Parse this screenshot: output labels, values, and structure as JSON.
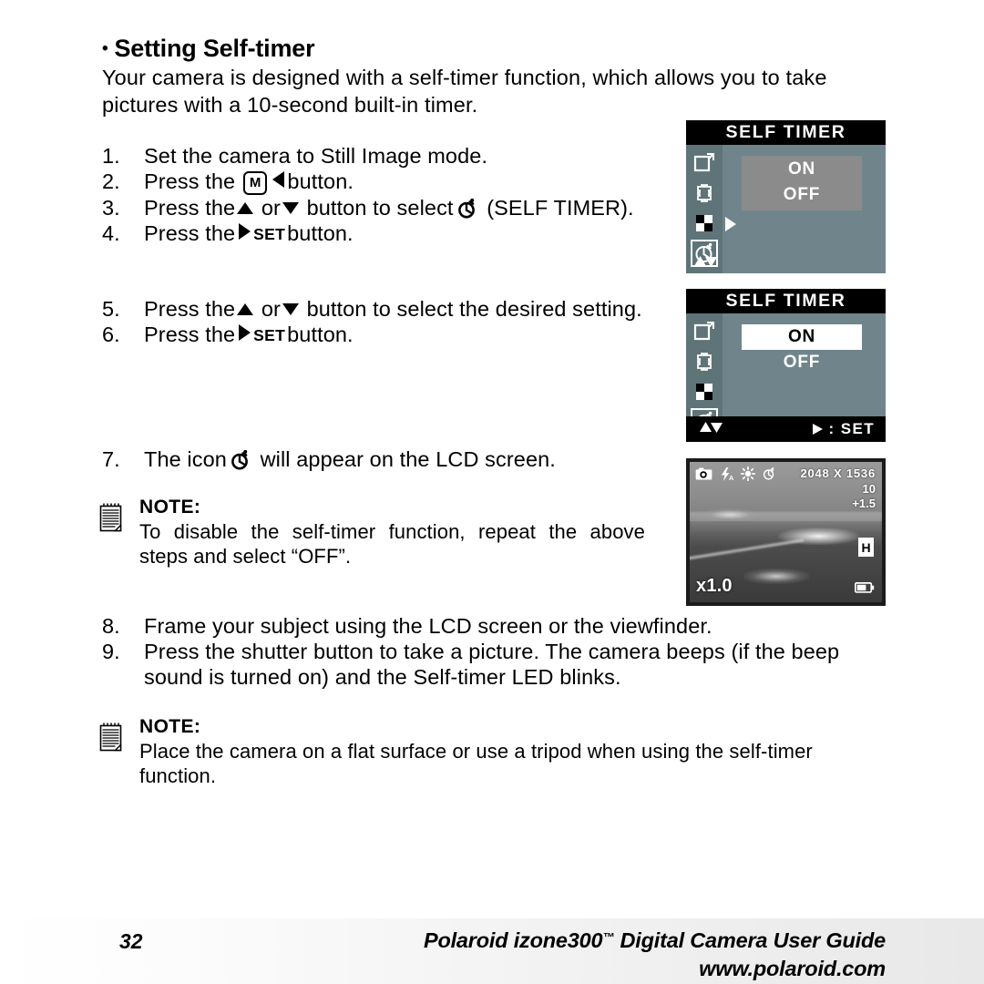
{
  "heading": {
    "bullet": "•",
    "title": "Setting Self-timer"
  },
  "intro": "Your camera is designed with a self-timer function, which allows you to take pictures with a 10-second built-in timer.",
  "steps_a": [
    {
      "num": "1.",
      "pre": "Set the camera to Still Image mode.",
      "post": ""
    },
    {
      "num": "2.",
      "pre": "Press the",
      "mid": "M",
      "post": "button."
    },
    {
      "num": "3.",
      "pre": "Press the",
      "mid2": "or",
      "post": "button to select",
      "tail": "(SELF TIMER)."
    },
    {
      "num": "4.",
      "pre": "Press the",
      "set": "SET",
      "post": "button."
    }
  ],
  "steps_b": [
    {
      "num": "5.",
      "pre": "Press the",
      "mid2": "or",
      "post": "button to select the desired setting."
    },
    {
      "num": "6.",
      "pre": "Press the",
      "set": "SET",
      "post": "button."
    }
  ],
  "steps_c": [
    {
      "num": "7.",
      "pre": "The icon",
      "post": "will appear on the LCD screen."
    }
  ],
  "steps_d": [
    {
      "num": "8.",
      "text": "Frame your subject using the LCD screen or the viewfinder."
    },
    {
      "num": "9.",
      "text": "Press the shutter button to take a picture. The camera beeps (if the beep sound is turned on) and the Self-timer LED blinks."
    }
  ],
  "note_a": {
    "label": "NOTE:",
    "text": "To disable the self-timer function, repeat the above steps and select “OFF”."
  },
  "note_b": {
    "label": "NOTE:",
    "text": "Place the camera on a flat surface or use a tripod when using the self-timer function."
  },
  "lcd_menu_1": {
    "title": "SELF TIMER",
    "options": [
      "ON",
      "OFF"
    ],
    "selected": null,
    "rail_icons": [
      "image-size-icon",
      "image-quality-icon",
      "sharpness-icon",
      "self-timer-icon"
    ],
    "rail_selected_index": 3,
    "footer_hint": "",
    "bg_color": "#6f858b",
    "rail_color": "#5f7478",
    "plate_color": "#8b8b8b"
  },
  "lcd_menu_2": {
    "title": "SELF TIMER",
    "options": [
      "ON",
      "OFF"
    ],
    "selected": "ON",
    "rail_icons": [
      "image-size-icon",
      "image-quality-icon",
      "sharpness-icon",
      "self-timer-icon"
    ],
    "rail_selected_index": 3,
    "footer_arrows": "▲▼",
    "footer_set": ": SET",
    "bg_color": "#6f858b",
    "rail_color": "#5f7478"
  },
  "lcd_preview": {
    "resolution": "2048 X 1536",
    "shots_remaining": "10",
    "exposure_value": "+1.5",
    "quality_badge": "H",
    "zoom": "x1.0",
    "icons": [
      "camera-mode-icon",
      "flash-auto-icon",
      "daylight-white-balance-icon",
      "self-timer-icon",
      "battery-icon"
    ]
  },
  "footer": {
    "page_number": "32",
    "title": "Polaroid izone300",
    "trademark": "™",
    "title_rest": " Digital Camera User Guide",
    "url": "www.polaroid.com"
  }
}
